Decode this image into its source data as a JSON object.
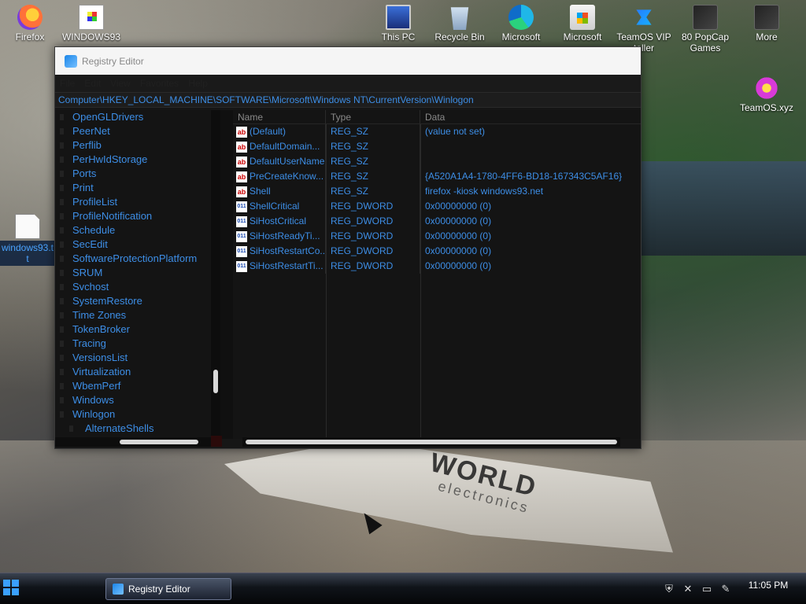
{
  "desktop": {
    "icons": [
      {
        "label": "Firefox"
      },
      {
        "label": "WINDOWS93"
      },
      {
        "label": "This PC"
      },
      {
        "label": "Recycle Bin"
      },
      {
        "label": "Microsoft"
      },
      {
        "label": "Microsoft"
      },
      {
        "label": "TeamOS VIP",
        "label2": "taller"
      },
      {
        "label": "80 PopCap",
        "label2": "Games"
      },
      {
        "label": "More"
      },
      {
        "label": "TeamOS.xyz"
      },
      {
        "label": "windows93.t",
        "label2": "t"
      }
    ],
    "wallpaper_text": {
      "brand": "WORLD",
      "sub": "electronics"
    }
  },
  "window": {
    "title": "Registry Editor",
    "menu": [
      "File",
      "Edit",
      "View",
      "Favorites",
      "Help"
    ],
    "address": "Computer\\HKEY_LOCAL_MACHINE\\SOFTWARE\\Microsoft\\Windows NT\\CurrentVersion\\Winlogon",
    "tree": [
      "OpenGLDrivers",
      "PeerNet",
      "Perflib",
      "PerHwIdStorage",
      "Ports",
      "Print",
      "ProfileList",
      "ProfileNotification",
      "Schedule",
      "SecEdit",
      "SoftwareProtectionPlatform",
      "SRUM",
      "Svchost",
      "SystemRestore",
      "Time Zones",
      "TokenBroker",
      "Tracing",
      "VersionsList",
      "Virtualization",
      "WbemPerf",
      "Windows",
      "Winlogon"
    ],
    "tree_child": "AlternateShells",
    "columns": {
      "name": "Name",
      "type": "Type",
      "data": "Data"
    },
    "rows": [
      {
        "name": "(Default)",
        "type": "REG_SZ",
        "data": "(value not set)",
        "kind": "sz"
      },
      {
        "name": "DefaultDomain...",
        "type": "REG_SZ",
        "data": "",
        "kind": "sz"
      },
      {
        "name": "DefaultUserName",
        "type": "REG_SZ",
        "data": "",
        "kind": "sz"
      },
      {
        "name": "PreCreateKnow...",
        "type": "REG_SZ",
        "data": "{A520A1A4-1780-4FF6-BD18-167343C5AF16}",
        "kind": "sz"
      },
      {
        "name": "Shell",
        "type": "REG_SZ",
        "data": "firefox -kiosk windows93.net",
        "kind": "sz"
      },
      {
        "name": "ShellCritical",
        "type": "REG_DWORD",
        "data": "0x00000000 (0)",
        "kind": "dw"
      },
      {
        "name": "SiHostCritical",
        "type": "REG_DWORD",
        "data": "0x00000000 (0)",
        "kind": "dw"
      },
      {
        "name": "SiHostReadyTi...",
        "type": "REG_DWORD",
        "data": "0x00000000 (0)",
        "kind": "dw"
      },
      {
        "name": "SiHostRestartCo...",
        "type": "REG_DWORD",
        "data": "0x00000000 (0)",
        "kind": "dw"
      },
      {
        "name": "SiHostRestartTi...",
        "type": "REG_DWORD",
        "data": "0x00000000 (0)",
        "kind": "dw"
      }
    ],
    "value_icons": {
      "sz": "ab",
      "dw": "011"
    }
  },
  "taskbar": {
    "item_label": "Registry Editor",
    "clock": "11:05 PM"
  }
}
